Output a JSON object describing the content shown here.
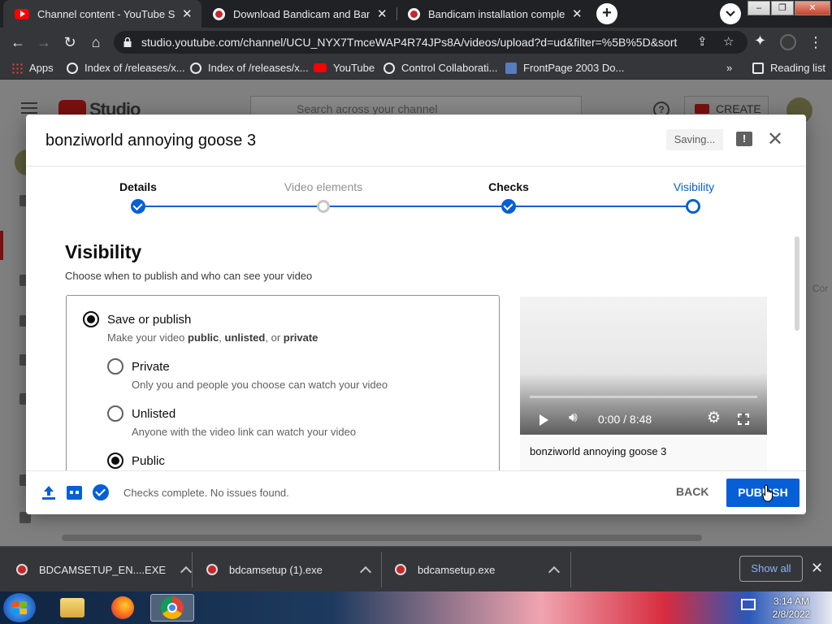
{
  "browser": {
    "tabs": [
      {
        "title": "Channel content - YouTube Studio",
        "icon": "youtube-icon",
        "active": true
      },
      {
        "title": "Download Bandicam and Bandicut",
        "icon": "bandicam-icon",
        "active": false
      },
      {
        "title": "Bandicam installation completed",
        "icon": "bandicam-icon",
        "active": false
      }
    ],
    "tab_close": "✕",
    "new_tab": "+",
    "url": "studio.youtube.com/channel/UCU_NYX7TmceWAP4R74JPs8A/videos/upload?d=ud&filter=%5B%5D&sort=...",
    "bookmarks": [
      {
        "label": "Apps",
        "icon": "apps-grid-icon"
      },
      {
        "label": "Index of /releases/x...",
        "icon": "globe-icon"
      },
      {
        "label": "Index of /releases/x...",
        "icon": "globe-icon"
      },
      {
        "label": "YouTube",
        "icon": "youtube-icon"
      },
      {
        "label": "Control Collaborati...",
        "icon": "globe-icon"
      },
      {
        "label": "FrontPage 2003 Do...",
        "icon": "frontpage-icon"
      }
    ],
    "bookmarks_more": "»",
    "reading_list": "Reading list"
  },
  "studio": {
    "logo_text": "Studio",
    "search_placeholder": "Search across your channel",
    "create_label": "CREATE",
    "help_glyph": "?",
    "side_text": "Cor"
  },
  "dialog": {
    "title": "bonziworld annoying goose 3",
    "saving": "Saving...",
    "feedback_glyph": "!",
    "close_glyph": "✕",
    "steps": [
      {
        "label": "Details",
        "state": "done"
      },
      {
        "label": "Video elements",
        "state": "todo"
      },
      {
        "label": "Checks",
        "state": "done"
      },
      {
        "label": "Visibility",
        "state": "current"
      }
    ],
    "visibility_title": "Visibility",
    "visibility_subtitle": "Choose when to publish and who can see your video",
    "save_or_publish": {
      "label": "Save or publish",
      "desc_pre": "Make your video ",
      "desc_public": "public",
      "desc_sep1": ", ",
      "desc_unlisted": "unlisted",
      "desc_sep2": ", or ",
      "desc_private": "private",
      "selected": true
    },
    "options": [
      {
        "label": "Private",
        "desc": "Only you and people you choose can watch your video",
        "selected": false
      },
      {
        "label": "Unlisted",
        "desc": "Anyone with the video link can watch your video",
        "selected": false
      },
      {
        "label": "Public",
        "desc": "",
        "selected": true
      }
    ],
    "player": {
      "time": "0:00 / 8:48",
      "video_title": "bonziworld annoying goose 3",
      "progress": 0
    },
    "footer": {
      "status": "Checks complete. No issues found.",
      "back": "BACK",
      "publish": "PUBLISH"
    }
  },
  "downloads": {
    "items": [
      {
        "name": "BDCAMSETUP_EN....EXE"
      },
      {
        "name": "bdcamsetup (1).exe"
      },
      {
        "name": "bdcamsetup.exe"
      }
    ],
    "show_all": "Show all",
    "close_glyph": "✕"
  },
  "taskbar": {
    "time": "3:14 AM",
    "date": "2/8/2022"
  },
  "colors": {
    "accent": "#065fd4",
    "youtube_red": "#ff0000",
    "chrome_dark": "#202124",
    "chrome_toolbar": "#35363a"
  }
}
